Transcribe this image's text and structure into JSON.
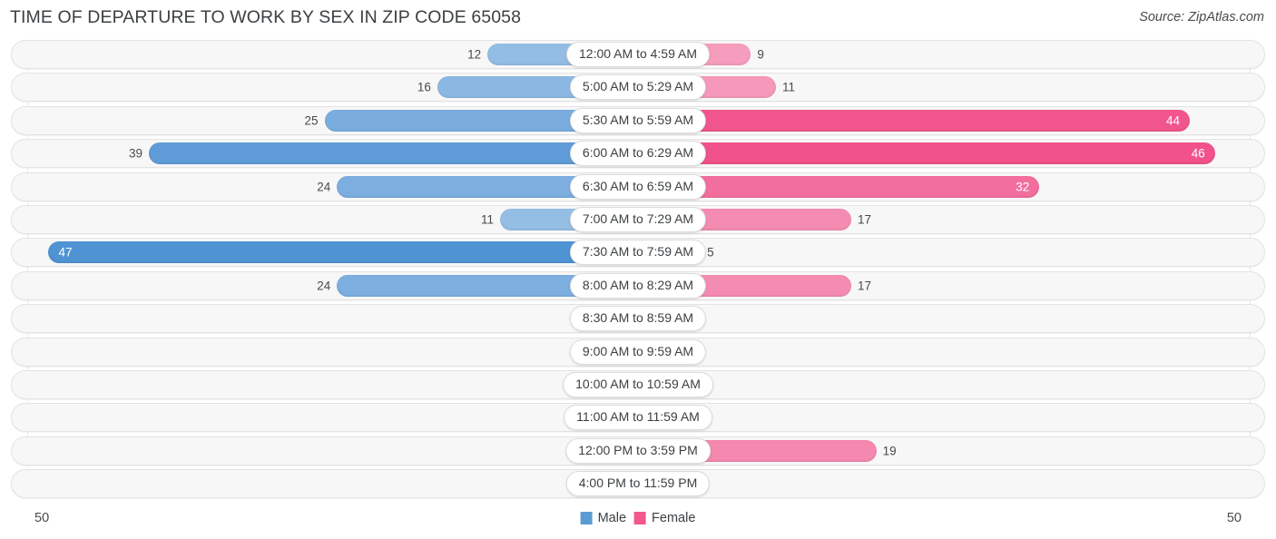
{
  "header": {
    "title": "TIME OF DEPARTURE TO WORK BY SEX IN ZIP CODE 65058",
    "source": "Source: ZipAtlas.com"
  },
  "legend": {
    "male_label": "Male",
    "female_label": "Female",
    "male_color": "#5b9bd5",
    "female_color": "#f2588c"
  },
  "axis": {
    "left_label": "50",
    "right_label": "50",
    "max": 50
  },
  "chart_data": {
    "type": "bar",
    "title": "TIME OF DEPARTURE TO WORK BY SEX IN ZIP CODE 65058",
    "subtitle": "Source: ZipAtlas.com",
    "orientation": "horizontal-diverging",
    "xlabel": "",
    "ylabel": "",
    "xlim": [
      50,
      50
    ],
    "grid": true,
    "legend_position": "bottom-center",
    "categories": [
      "12:00 AM to 4:59 AM",
      "5:00 AM to 5:29 AM",
      "5:30 AM to 5:59 AM",
      "6:00 AM to 6:29 AM",
      "6:30 AM to 6:59 AM",
      "7:00 AM to 7:29 AM",
      "7:30 AM to 7:59 AM",
      "8:00 AM to 8:29 AM",
      "8:30 AM to 8:59 AM",
      "9:00 AM to 9:59 AM",
      "10:00 AM to 10:59 AM",
      "11:00 AM to 11:59 AM",
      "12:00 PM to 3:59 PM",
      "4:00 PM to 11:59 PM"
    ],
    "series": [
      {
        "name": "Male",
        "values": [
          12,
          16,
          25,
          39,
          24,
          11,
          47,
          24,
          0,
          0,
          0,
          0,
          2,
          0
        ]
      },
      {
        "name": "Female",
        "values": [
          9,
          11,
          44,
          46,
          32,
          17,
          5,
          17,
          0,
          0,
          0,
          0,
          19,
          2
        ]
      }
    ]
  },
  "rows": [
    {
      "category": "12:00 AM to 4:59 AM",
      "male": 12,
      "female": 9
    },
    {
      "category": "5:00 AM to 5:29 AM",
      "male": 16,
      "female": 11
    },
    {
      "category": "5:30 AM to 5:59 AM",
      "male": 25,
      "female": 44
    },
    {
      "category": "6:00 AM to 6:29 AM",
      "male": 39,
      "female": 46
    },
    {
      "category": "6:30 AM to 6:59 AM",
      "male": 24,
      "female": 32
    },
    {
      "category": "7:00 AM to 7:29 AM",
      "male": 11,
      "female": 17
    },
    {
      "category": "7:30 AM to 7:59 AM",
      "male": 47,
      "female": 5
    },
    {
      "category": "8:00 AM to 8:29 AM",
      "male": 24,
      "female": 17
    },
    {
      "category": "8:30 AM to 8:59 AM",
      "male": 0,
      "female": 0
    },
    {
      "category": "9:00 AM to 9:59 AM",
      "male": 0,
      "female": 0
    },
    {
      "category": "10:00 AM to 10:59 AM",
      "male": 0,
      "female": 0
    },
    {
      "category": "11:00 AM to 11:59 AM",
      "male": 0,
      "female": 0
    },
    {
      "category": "12:00 PM to 3:59 PM",
      "male": 2,
      "female": 19
    },
    {
      "category": "4:00 PM to 11:59 PM",
      "male": 0,
      "female": 2
    }
  ]
}
